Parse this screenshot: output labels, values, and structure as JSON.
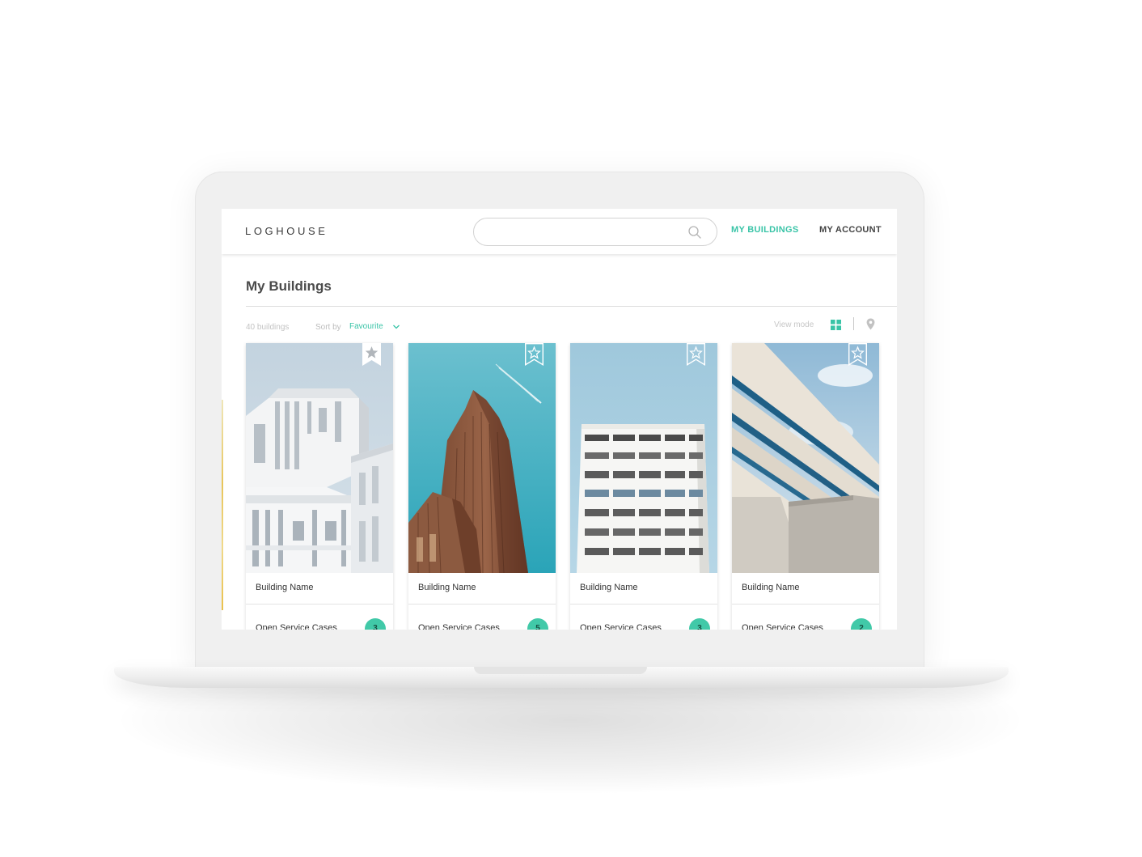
{
  "app": {
    "logo": "LOGHOUSE",
    "nav": {
      "buildings": "MY BUILDINGS",
      "account": "MY ACCOUNT"
    },
    "search": {
      "value": "",
      "placeholder": ""
    }
  },
  "page": {
    "title": "My Buildings",
    "count": "40 buildings",
    "sort_label": "Sort by",
    "sort_value": "Favourite",
    "view_mode_label": "View mode",
    "active_view": "grid"
  },
  "colors": {
    "accent": "#39c4a7",
    "badge": "#41c9a8"
  },
  "cards": [
    {
      "name": "Building Name",
      "cases_label": "Open Service Cases",
      "cases_count": "3",
      "favourite": true
    },
    {
      "name": "Building Name",
      "cases_label": "Open Service Cases",
      "cases_count": "5",
      "favourite": false
    },
    {
      "name": "Building Name",
      "cases_label": "Open Service Cases",
      "cases_count": "3",
      "favourite": false
    },
    {
      "name": "Building Name",
      "cases_label": "Open Service Cases",
      "cases_count": "2",
      "favourite": false
    }
  ]
}
